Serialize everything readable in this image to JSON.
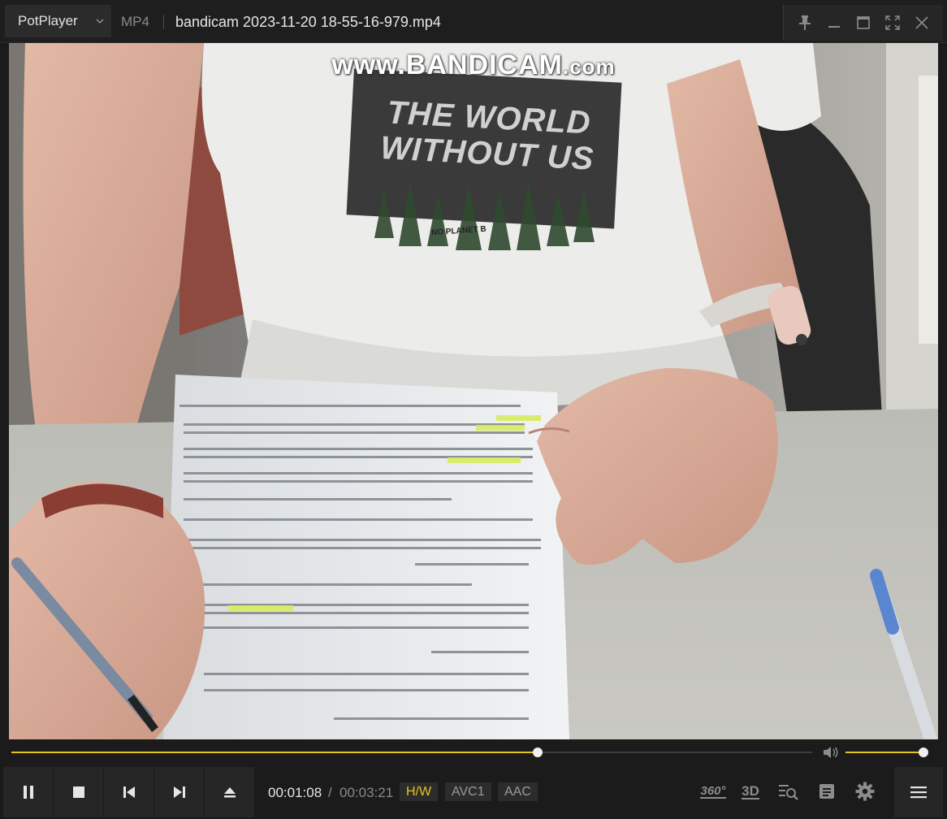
{
  "titlebar": {
    "app_name": "PotPlayer",
    "format": "MP4",
    "file_name": "bandicam 2023-11-20 18-55-16-979.mp4",
    "window_controls": [
      "pin-icon",
      "minimize-icon",
      "maximize-icon",
      "fullscreen-icon",
      "close-icon"
    ]
  },
  "video": {
    "watermark_main": "www.BANDICAM",
    "watermark_suffix": ".com",
    "shirt_line1": "THE WORLD",
    "shirt_line2": "WITHOUT US",
    "shirt_small": "NO PLANET B"
  },
  "playback": {
    "progress_fraction": 0.657,
    "volume_fraction": 1.0,
    "current_time": "00:01:08",
    "separator": "/",
    "total_time": "00:03:21",
    "badges": [
      "H/W",
      "AVC1",
      "AAC"
    ]
  },
  "controls": {
    "buttons": [
      "pause-icon",
      "stop-icon",
      "previous-icon",
      "next-icon",
      "eject-icon"
    ],
    "right_icons": [
      "360",
      "3D",
      "playlist-search-icon",
      "chat-icon",
      "gear-icon",
      "menu-icon"
    ],
    "label_360": "360°",
    "label_3d": "3D"
  },
  "colors": {
    "accent": "#e8c31e",
    "background": "#1b1b1b",
    "panel": "#262626"
  }
}
